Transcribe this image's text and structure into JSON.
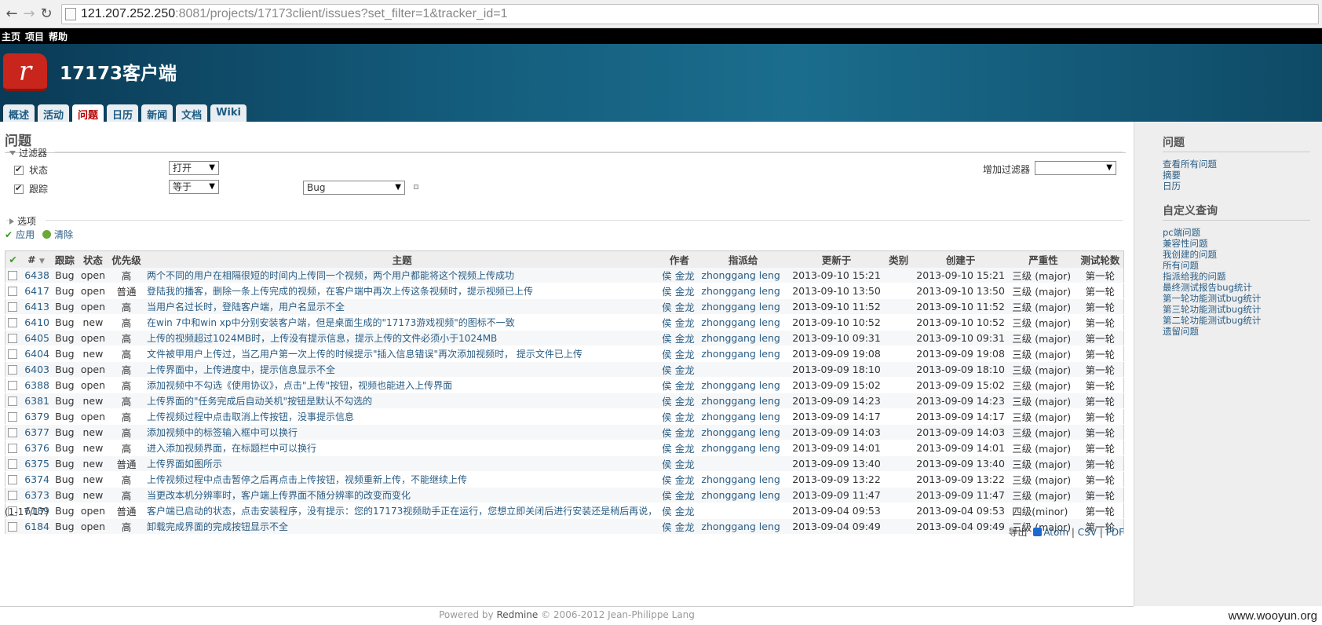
{
  "browser": {
    "url_host": "121.207.252.250",
    "url_rest": ":8081/projects/17173client/issues?set_filter=1&tracker_id=1"
  },
  "top_menu": [
    "主页",
    "项目",
    "帮助"
  ],
  "header": {
    "project_title": "17173客户端",
    "tabs": [
      {
        "label": "概述",
        "selected": false
      },
      {
        "label": "活动",
        "selected": false
      },
      {
        "label": "问题",
        "selected": true
      },
      {
        "label": "日历",
        "selected": false
      },
      {
        "label": "新闻",
        "selected": false
      },
      {
        "label": "文档",
        "selected": false
      },
      {
        "label": "Wiki",
        "selected": false
      }
    ]
  },
  "main": {
    "title": "问题",
    "filters_legend": "过滤器",
    "filters": [
      {
        "label": "状态",
        "operator": "打开",
        "value": ""
      },
      {
        "label": "跟踪",
        "operator": "等于",
        "value": "Bug"
      }
    ],
    "add_filter_label": "增加过滤器",
    "options_legend": "选项",
    "apply_label": "应用",
    "clear_label": "清除",
    "columns": [
      "#",
      "跟踪",
      "状态",
      "优先级",
      "主题",
      "作者",
      "指派给",
      "更新于",
      "类别",
      "创建于",
      "严重性",
      "测试轮数"
    ],
    "issues": [
      {
        "id": "6438",
        "tracker": "Bug",
        "status": "open",
        "priority": "高",
        "subject": "两个不同的用户在相隔很短的时间内上传同一个视频，两个用户都能将这个视频上传成功",
        "author": "侯 金龙",
        "assigned": "zhonggang leng",
        "updated": "2013-09-10 15:21",
        "created": "2013-09-10 15:21",
        "severity": "三级 (major)",
        "round": "第一轮"
      },
      {
        "id": "6417",
        "tracker": "Bug",
        "status": "open",
        "priority": "普通",
        "subject": "登陆我的播客，删除一条上传完成的视频，在客户端中再次上传这条视频时，提示视频已上传",
        "author": "侯 金龙",
        "assigned": "zhonggang leng",
        "updated": "2013-09-10 13:50",
        "created": "2013-09-10 13:50",
        "severity": "三级 (major)",
        "round": "第一轮"
      },
      {
        "id": "6413",
        "tracker": "Bug",
        "status": "open",
        "priority": "高",
        "subject": "当用户名过长时，登陆客户端，用户名显示不全",
        "author": "侯 金龙",
        "assigned": "zhonggang leng",
        "updated": "2013-09-10 11:52",
        "created": "2013-09-10 11:52",
        "severity": "三级 (major)",
        "round": "第一轮"
      },
      {
        "id": "6410",
        "tracker": "Bug",
        "status": "new",
        "priority": "高",
        "subject": "在win 7中和win xp中分别安装客户端，但是桌面生成的\"17173游戏视频\"的图标不一致",
        "author": "侯 金龙",
        "assigned": "zhonggang leng",
        "updated": "2013-09-10 10:52",
        "created": "2013-09-10 10:52",
        "severity": "三级 (major)",
        "round": "第一轮"
      },
      {
        "id": "6405",
        "tracker": "Bug",
        "status": "open",
        "priority": "高",
        "subject": "上传的视频超过1024MB时，上传没有提示信息，提示上传的文件必须小于1024MB",
        "author": "侯 金龙",
        "assigned": "zhonggang leng",
        "updated": "2013-09-10 09:31",
        "created": "2013-09-10 09:31",
        "severity": "三级 (major)",
        "round": "第一轮"
      },
      {
        "id": "6404",
        "tracker": "Bug",
        "status": "new",
        "priority": "高",
        "subject": "文件被甲用户上传过，当乙用户第一次上传的时候提示\"插入信息错误\"再次添加视频时， 提示文件已上传",
        "author": "侯 金龙",
        "assigned": "zhonggang leng",
        "updated": "2013-09-09 19:08",
        "created": "2013-09-09 19:08",
        "severity": "三级 (major)",
        "round": "第一轮"
      },
      {
        "id": "6403",
        "tracker": "Bug",
        "status": "open",
        "priority": "高",
        "subject": "上传界面中，上传进度中，提示信息显示不全",
        "author": "侯 金龙",
        "assigned": "",
        "updated": "2013-09-09 18:10",
        "created": "2013-09-09 18:10",
        "severity": "三级 (major)",
        "round": "第一轮"
      },
      {
        "id": "6388",
        "tracker": "Bug",
        "status": "open",
        "priority": "高",
        "subject": "添加视频中不勾选《使用协议》，点击\"上传\"按钮，视频也能进入上传界面",
        "author": "侯 金龙",
        "assigned": "zhonggang leng",
        "updated": "2013-09-09 15:02",
        "created": "2013-09-09 15:02",
        "severity": "三级 (major)",
        "round": "第一轮"
      },
      {
        "id": "6381",
        "tracker": "Bug",
        "status": "new",
        "priority": "高",
        "subject": "上传界面的\"任务完成后自动关机\"按钮是默认不勾选的",
        "author": "侯 金龙",
        "assigned": "zhonggang leng",
        "updated": "2013-09-09 14:23",
        "created": "2013-09-09 14:23",
        "severity": "三级 (major)",
        "round": "第一轮"
      },
      {
        "id": "6379",
        "tracker": "Bug",
        "status": "open",
        "priority": "高",
        "subject": "上传视频过程中点击取消上传按钮，没事提示信息",
        "author": "侯 金龙",
        "assigned": "zhonggang leng",
        "updated": "2013-09-09 14:17",
        "created": "2013-09-09 14:17",
        "severity": "三级 (major)",
        "round": "第一轮"
      },
      {
        "id": "6377",
        "tracker": "Bug",
        "status": "new",
        "priority": "高",
        "subject": "添加视频中的标签输入框中可以换行",
        "author": "侯 金龙",
        "assigned": "zhonggang leng",
        "updated": "2013-09-09 14:03",
        "created": "2013-09-09 14:03",
        "severity": "三级 (major)",
        "round": "第一轮"
      },
      {
        "id": "6376",
        "tracker": "Bug",
        "status": "new",
        "priority": "高",
        "subject": "进入添加视频界面，在标题栏中可以换行",
        "author": "侯 金龙",
        "assigned": "zhonggang leng",
        "updated": "2013-09-09 14:01",
        "created": "2013-09-09 14:01",
        "severity": "三级 (major)",
        "round": "第一轮"
      },
      {
        "id": "6375",
        "tracker": "Bug",
        "status": "new",
        "priority": "普通",
        "subject": "上传界面如图所示",
        "author": "侯 金龙",
        "assigned": "",
        "updated": "2013-09-09 13:40",
        "created": "2013-09-09 13:40",
        "severity": "三级 (major)",
        "round": "第一轮"
      },
      {
        "id": "6374",
        "tracker": "Bug",
        "status": "new",
        "priority": "高",
        "subject": "上传视频过程中点击暂停之后再点击上传按钮，视频重新上传，不能继续上传",
        "author": "侯 金龙",
        "assigned": "zhonggang leng",
        "updated": "2013-09-09 13:22",
        "created": "2013-09-09 13:22",
        "severity": "三级 (major)",
        "round": "第一轮"
      },
      {
        "id": "6373",
        "tracker": "Bug",
        "status": "new",
        "priority": "高",
        "subject": "当更改本机分辨率时，客户端上传界面不随分辨率的改变而变化",
        "author": "侯 金龙",
        "assigned": "zhonggang leng",
        "updated": "2013-09-09 11:47",
        "created": "2013-09-09 11:47",
        "severity": "三级 (major)",
        "round": "第一轮"
      },
      {
        "id": "6189",
        "tracker": "Bug",
        "status": "open",
        "priority": "普通",
        "subject": "客户端已启动的状态，点击安装程序，没有提示：您的17173视频助手正在运行，您想立即关闭后进行安装还是稍后再说，",
        "author": "侯 金龙",
        "assigned": "",
        "updated": "2013-09-04 09:53",
        "created": "2013-09-04 09:53",
        "severity": "四级(minor)",
        "round": "第一轮"
      },
      {
        "id": "6184",
        "tracker": "Bug",
        "status": "open",
        "priority": "高",
        "subject": "卸载完成界面的完成按钮显示不全",
        "author": "侯 金龙",
        "assigned": "zhonggang leng",
        "updated": "2013-09-04 09:49",
        "created": "2013-09-04 09:49",
        "severity": "三级 (major)",
        "round": "第一轮"
      }
    ],
    "count": "(1-17/17)",
    "export_label": "导出",
    "export_formats": [
      "Atom",
      "CSV",
      "PDF"
    ]
  },
  "sidebar": {
    "issues_heading": "问题",
    "issues_links": [
      "查看所有问题",
      "摘要",
      "日历"
    ],
    "queries_heading": "自定义查询",
    "queries_links": [
      "pc端问题",
      "兼容性问题",
      "我创建的问题",
      "所有问题",
      "指派给我的问题",
      "最终测试报告bug统计",
      "第一轮功能测试bug统计",
      "第三轮功能测试bug统计",
      "第二轮功能测试bug统计",
      "遗留问题"
    ]
  },
  "footer": {
    "prefix": "Powered by",
    "link": "Redmine",
    "suffix": "© 2006-2012 Jean-Philippe Lang"
  },
  "watermark": "www.wooyun.org"
}
